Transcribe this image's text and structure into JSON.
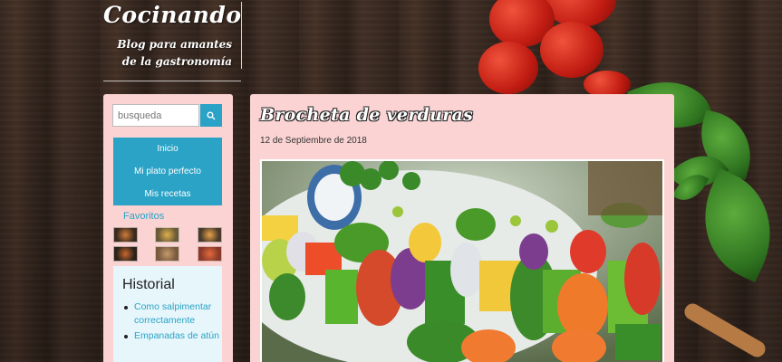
{
  "site": {
    "title": "Cocinando",
    "tagline": "Blog para amantes de la gastronomía"
  },
  "search": {
    "placeholder": "busqueda",
    "button_icon": "search-icon"
  },
  "nav": {
    "items": [
      {
        "label": "Inicio"
      },
      {
        "label": "Mi plato perfecto"
      },
      {
        "label": "Mis recetas"
      }
    ]
  },
  "favorites": {
    "title": "Favoritos"
  },
  "history": {
    "title": "Historial",
    "items": [
      {
        "label": "Como salpimentar correctamente"
      },
      {
        "label": "Empanadas de atún"
      }
    ]
  },
  "post": {
    "title": "Brocheta de verduras",
    "date": "12 de Septiembre de 2018"
  },
  "colors": {
    "accent": "#2aa3c6",
    "panel": "#fbd3d3",
    "history_bg": "#e6f6fb"
  }
}
